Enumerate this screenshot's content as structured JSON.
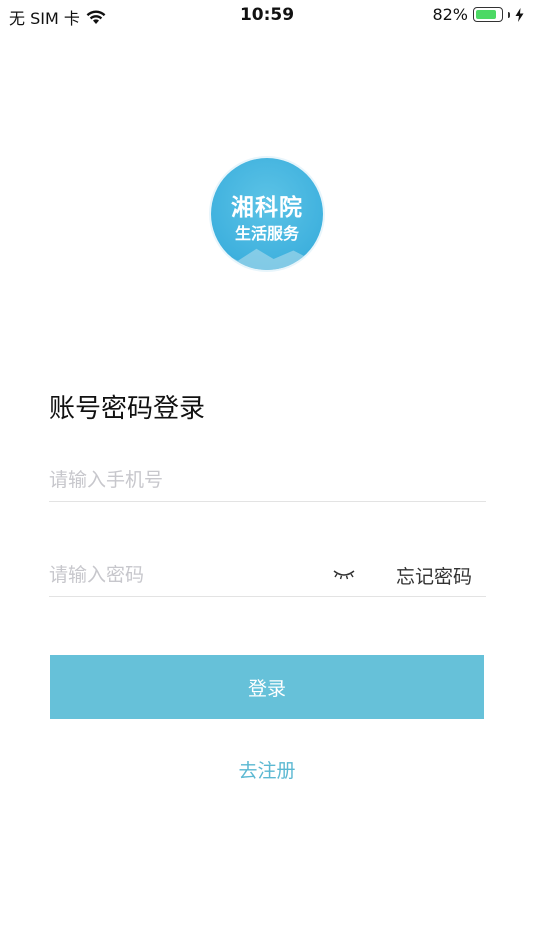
{
  "status_bar": {
    "carrier": "无 SIM 卡",
    "time": "10:59",
    "battery_percent": "82%",
    "battery_level": 0.82
  },
  "logo": {
    "line1": "湘科院",
    "line2": "生活服务"
  },
  "form": {
    "title": "账号密码登录",
    "phone_placeholder": "请输入手机号",
    "phone_value": "",
    "password_placeholder": "请输入密码",
    "password_value": "",
    "forgot_label": "忘记密码",
    "eye_icon": "eye-closed-icon"
  },
  "actions": {
    "login_label": "登录",
    "register_label": "去注册"
  },
  "colors": {
    "accent": "#66c1d9",
    "link": "#5bb8d2",
    "battery": "#4cd964"
  }
}
